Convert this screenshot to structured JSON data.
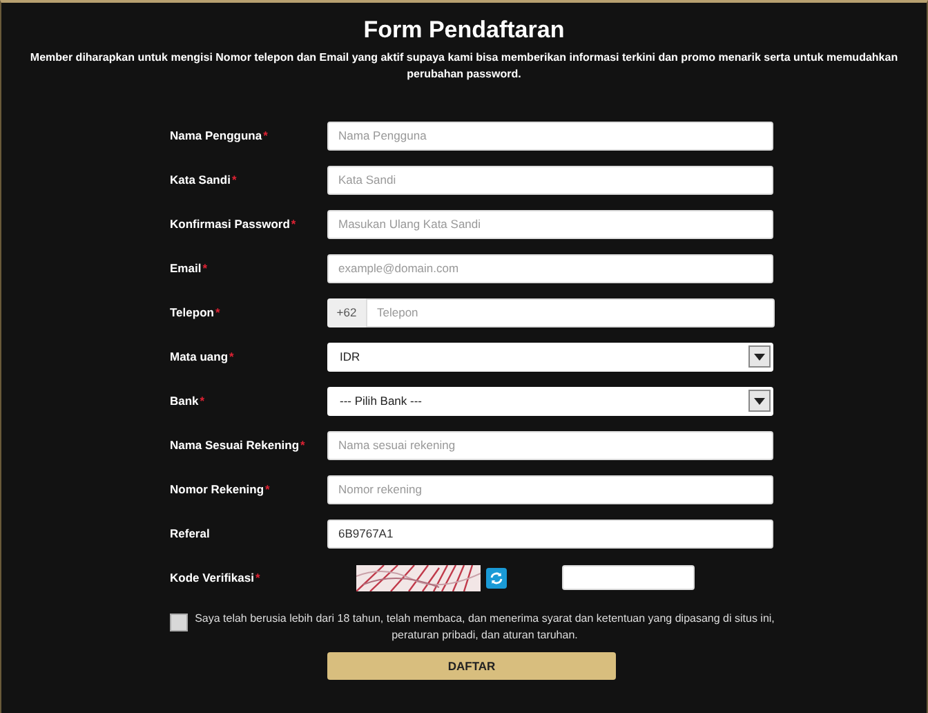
{
  "title": "Form Pendaftaran",
  "description": "Member diharapkan untuk mengisi Nomor telepon dan Email yang aktif supaya kami bisa memberikan informasi terkini dan promo menarik serta untuk memudahkan perubahan password.",
  "fields": [
    {
      "kind": "text",
      "label": "Nama Pengguna",
      "mark": "*",
      "placeholder": "Nama Pengguna"
    },
    {
      "kind": "text",
      "label": "Kata Sandi",
      "mark": "*",
      "placeholder": "Kata Sandi"
    },
    {
      "kind": "text",
      "label": "Konfirmasi Password",
      "mark": "*",
      "placeholder": "Masukan Ulang Kata Sandi"
    },
    {
      "kind": "text",
      "label": "Email",
      "mark": "*",
      "placeholder": "example@domain.com"
    },
    {
      "kind": "phone",
      "label": "Telepon",
      "mark": "*",
      "prefix": "+62",
      "placeholder": "Telepon"
    },
    {
      "kind": "select",
      "label": "Mata uang",
      "mark": "*",
      "value": "IDR"
    },
    {
      "kind": "select",
      "label": "Bank",
      "mark": "*",
      "value": "--- Pilih Bank ---"
    },
    {
      "kind": "text",
      "label": "Nama Sesuai Rekening",
      "mark": "*",
      "placeholder": "Nama sesuai rekening"
    },
    {
      "kind": "text",
      "label": "Nomor Rekening",
      "mark": "*",
      "placeholder": "Nomor rekening"
    },
    {
      "kind": "text",
      "label": "Referal",
      "value": "6B9767A1"
    },
    {
      "kind": "captcha",
      "label": "Kode Verifikasi",
      "mark": "*"
    }
  ],
  "agreement": {
    "checked": false,
    "text": "Saya telah berusia lebih dari 18 tahun, telah membaca, dan menerima syarat dan ketentuan yang dipasang di situs ini, peraturan pribadi, dan aturan taruhan."
  },
  "submit": "DAFTAR"
}
